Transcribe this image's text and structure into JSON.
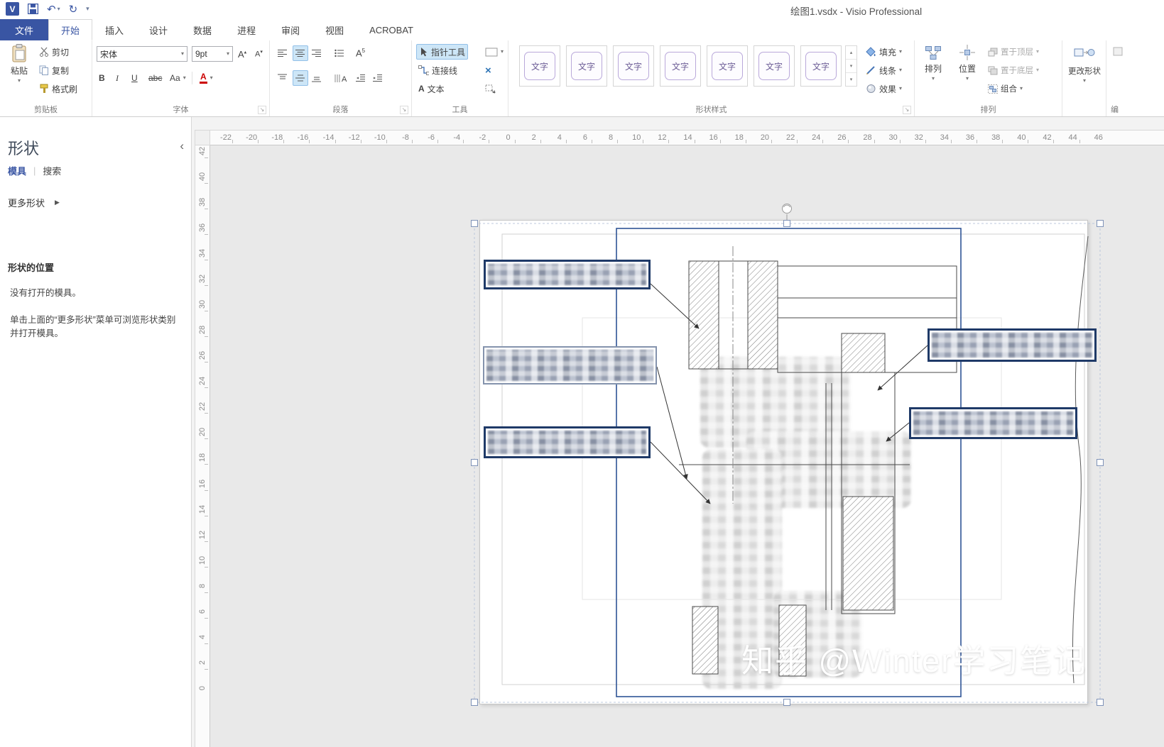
{
  "titlebar": {
    "title": "绘图1.vsdx - Visio Professional"
  },
  "tabs": {
    "file": "文件",
    "items": [
      "开始",
      "插入",
      "设计",
      "数据",
      "进程",
      "审阅",
      "视图",
      "ACROBAT"
    ]
  },
  "ribbon": {
    "clipboard": {
      "label": "剪贴板",
      "paste": "粘贴",
      "cut": "剪切",
      "copy": "复制",
      "format_painter": "格式刷"
    },
    "font": {
      "label": "字体",
      "family": "宋体",
      "size": "9pt",
      "bold": "B",
      "italic": "I",
      "underline": "U",
      "strike": "abc",
      "case_btn": "Aa",
      "color_btn": "A"
    },
    "paragraph": {
      "label": "段落"
    },
    "tools": {
      "label": "工具",
      "pointer": "指针工具",
      "connector": "连接线",
      "text_btn": "文本",
      "text_icon": "A",
      "delete_x": "×"
    },
    "shape_styles": {
      "label": "形状样式",
      "gallery_item": "文字",
      "fill": "填充",
      "line": "线条",
      "effects": "效果"
    },
    "arrange": {
      "label": "排列",
      "arrange_btn": "排列",
      "position": "位置",
      "bring_to_front": "置于顶层",
      "send_to_back": "置于底层",
      "group": "组合"
    },
    "change_shape": {
      "label": "更改形状"
    },
    "edit_partial": {
      "label": "编"
    }
  },
  "shapes_panel": {
    "title": "形状",
    "tab_stencils": "模具",
    "tab_search": "搜索",
    "more_shapes": "更多形状",
    "section_title": "形状的位置",
    "empty_text": "没有打开的模具。",
    "hint_text": "单击上面的“更多形状”菜单可浏览形状类别并打开模具。"
  },
  "rulers": {
    "h_ticks": [
      -22,
      -20,
      -18,
      -16,
      -14,
      -12,
      -10,
      -8,
      -6,
      -4,
      -2,
      0,
      2,
      4,
      6,
      8,
      10,
      12,
      14,
      16,
      18,
      20,
      22,
      24,
      26,
      28,
      30,
      32,
      34,
      36,
      38,
      40,
      42,
      44,
      46
    ],
    "v_ticks": [
      42,
      40,
      38,
      36,
      34,
      32,
      30,
      28,
      26,
      24,
      22,
      20,
      18,
      16,
      14,
      12,
      10,
      8,
      6,
      4,
      2,
      0
    ]
  },
  "canvas": {
    "watermark": "知乎 @Winter学习笔记"
  },
  "colors": {
    "accent": "#3955a3",
    "callout_border": "#1f3a68",
    "selection_blue": "#2f5496"
  }
}
